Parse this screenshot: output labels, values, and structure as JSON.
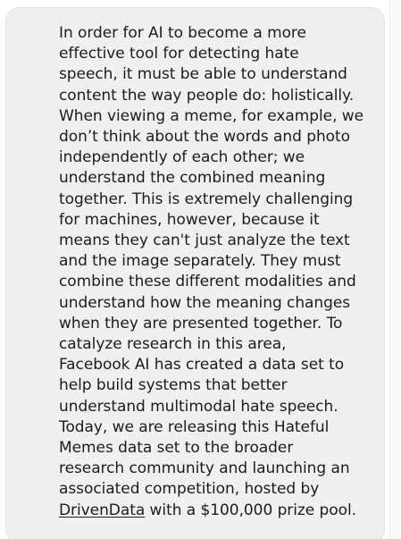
{
  "post": {
    "lines": [
      "In order for AI to become a more",
      "effective tool for detecting hate",
      "speech, it must be able to understand",
      "content the way people do: holistically.",
      "When viewing a meme, for example, we",
      "don’t think about the words and photo",
      "independently of each other; we",
      "understand the combined meaning",
      "together. This is extremely challenging",
      "for machines, however, because it",
      "means they can't just analyze the text",
      "and the image separately. They must",
      "combine these different modalities and",
      "understand how the meaning changes",
      "when they are presented together. To",
      "catalyze research in this area,",
      "Facebook AI has created a data set to",
      "help build systems that better",
      "understand multimodal hate speech.",
      "Today, we are releasing this Hateful",
      "Memes data set to the broader",
      "research community and launching an",
      "associated competition, hosted by"
    ],
    "link_text": "DrivenData",
    "final_line_rest": " with a $100,000 prize pool."
  }
}
